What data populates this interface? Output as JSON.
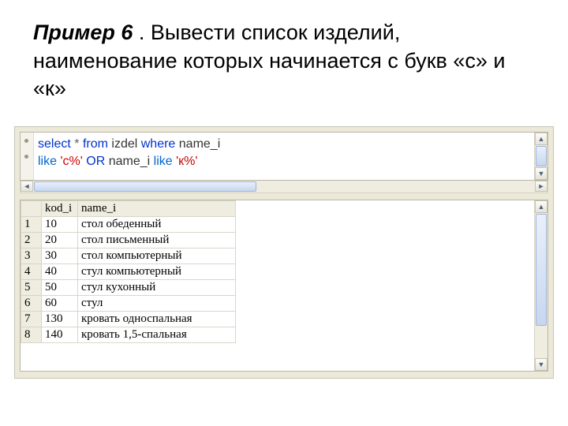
{
  "heading": {
    "label": "Пример 6",
    "rest": " . Вывести список изделий, наименование которых начинается с букв «с» и «к»"
  },
  "sql": {
    "line1": {
      "select": "select",
      "star": "*",
      "from": "from",
      "table": "izdel",
      "where": "where",
      "col": "name_i"
    },
    "line2": {
      "like1": "like",
      "str1": "'с%'",
      "or": "OR",
      "col2": "name_i",
      "like2": "like",
      "str2": "'к%'"
    }
  },
  "grid": {
    "headers": {
      "kod": "kod_i",
      "name": "name_i"
    },
    "rows": [
      {
        "n": "1",
        "kod": "10",
        "name": "стол обеденный"
      },
      {
        "n": "2",
        "kod": "20",
        "name": "стол письменный"
      },
      {
        "n": "3",
        "kod": "30",
        "name": "стол компьютерный"
      },
      {
        "n": "4",
        "kod": "40",
        "name": "стул компьютерный"
      },
      {
        "n": "5",
        "kod": "50",
        "name": "стул кухонный"
      },
      {
        "n": "6",
        "kod": "60",
        "name": "стул"
      },
      {
        "n": "7",
        "kod": "130",
        "name": "кровать односпальная"
      },
      {
        "n": "8",
        "kod": "140",
        "name": "кровать 1,5-спальная"
      }
    ]
  },
  "scroll": {
    "up": "▲",
    "down": "▼",
    "left": "◄",
    "right": "►"
  }
}
